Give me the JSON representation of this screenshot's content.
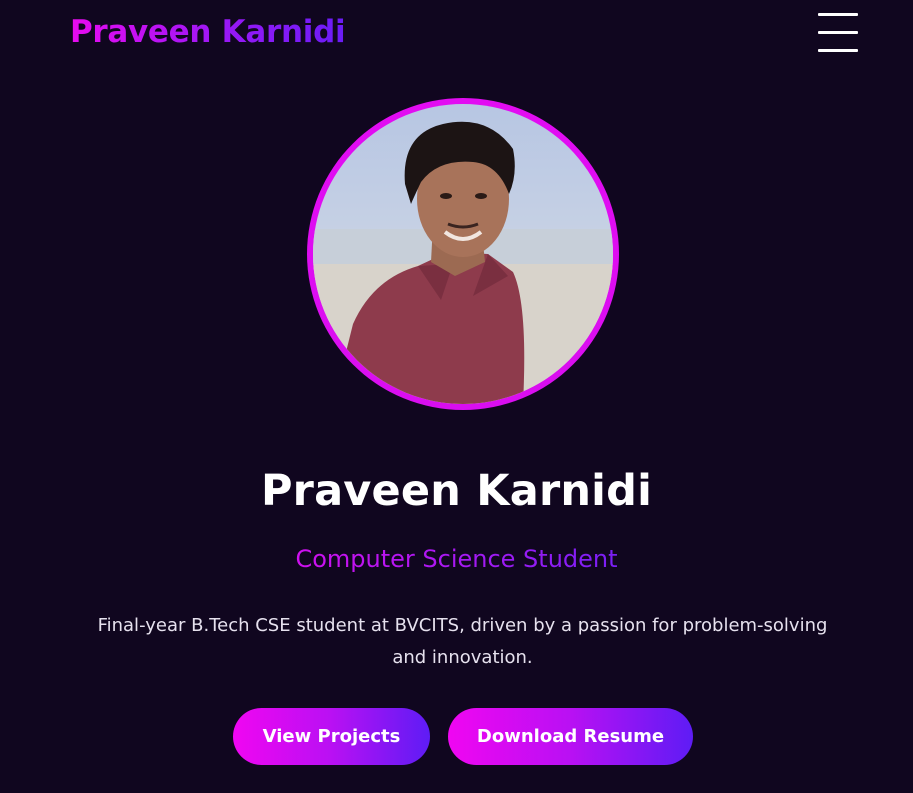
{
  "header": {
    "brand": "Praveen Karnidi",
    "menu_icon": "hamburger-menu-icon"
  },
  "hero": {
    "avatar_alt": "Profile photo",
    "name": "Praveen Karnidi",
    "role": "Computer Science Student",
    "bio": "Final-year B.Tech CSE student at BVCITS, driven by a passion for problem-solving and innovation."
  },
  "actions": {
    "view_projects_label": "View Projects",
    "download_resume_label": "Download Resume"
  },
  "colors": {
    "background": "#10061f",
    "accent_start": "#f006f2",
    "accent_end": "#5e1cf5",
    "ring": "#e20cf2"
  }
}
